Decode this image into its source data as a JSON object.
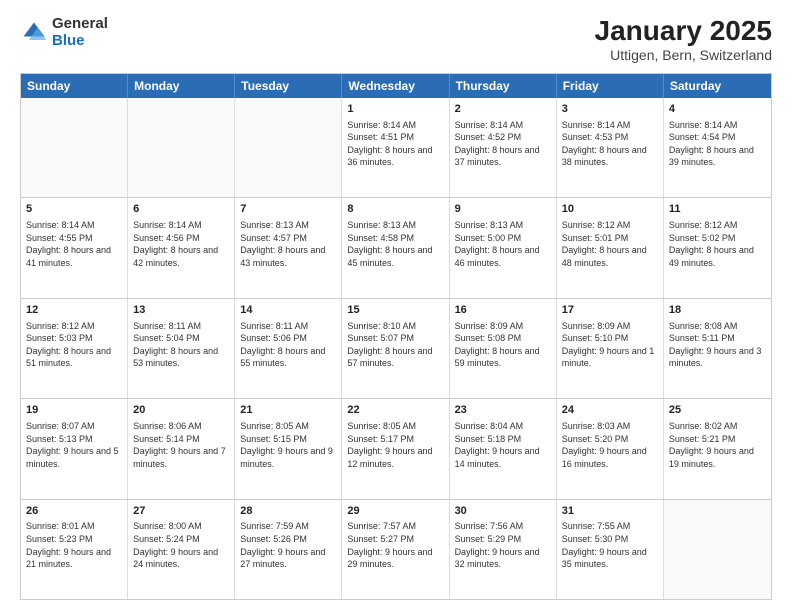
{
  "header": {
    "logo_general": "General",
    "logo_blue": "Blue",
    "title": "January 2025",
    "subtitle": "Uttigen, Bern, Switzerland"
  },
  "calendar": {
    "days_of_week": [
      "Sunday",
      "Monday",
      "Tuesday",
      "Wednesday",
      "Thursday",
      "Friday",
      "Saturday"
    ],
    "weeks": [
      [
        {
          "day": "",
          "text": ""
        },
        {
          "day": "",
          "text": ""
        },
        {
          "day": "",
          "text": ""
        },
        {
          "day": "1",
          "text": "Sunrise: 8:14 AM\nSunset: 4:51 PM\nDaylight: 8 hours\nand 36 minutes."
        },
        {
          "day": "2",
          "text": "Sunrise: 8:14 AM\nSunset: 4:52 PM\nDaylight: 8 hours\nand 37 minutes."
        },
        {
          "day": "3",
          "text": "Sunrise: 8:14 AM\nSunset: 4:53 PM\nDaylight: 8 hours\nand 38 minutes."
        },
        {
          "day": "4",
          "text": "Sunrise: 8:14 AM\nSunset: 4:54 PM\nDaylight: 8 hours\nand 39 minutes."
        }
      ],
      [
        {
          "day": "5",
          "text": "Sunrise: 8:14 AM\nSunset: 4:55 PM\nDaylight: 8 hours\nand 41 minutes."
        },
        {
          "day": "6",
          "text": "Sunrise: 8:14 AM\nSunset: 4:56 PM\nDaylight: 8 hours\nand 42 minutes."
        },
        {
          "day": "7",
          "text": "Sunrise: 8:13 AM\nSunset: 4:57 PM\nDaylight: 8 hours\nand 43 minutes."
        },
        {
          "day": "8",
          "text": "Sunrise: 8:13 AM\nSunset: 4:58 PM\nDaylight: 8 hours\nand 45 minutes."
        },
        {
          "day": "9",
          "text": "Sunrise: 8:13 AM\nSunset: 5:00 PM\nDaylight: 8 hours\nand 46 minutes."
        },
        {
          "day": "10",
          "text": "Sunrise: 8:12 AM\nSunset: 5:01 PM\nDaylight: 8 hours\nand 48 minutes."
        },
        {
          "day": "11",
          "text": "Sunrise: 8:12 AM\nSunset: 5:02 PM\nDaylight: 8 hours\nand 49 minutes."
        }
      ],
      [
        {
          "day": "12",
          "text": "Sunrise: 8:12 AM\nSunset: 5:03 PM\nDaylight: 8 hours\nand 51 minutes."
        },
        {
          "day": "13",
          "text": "Sunrise: 8:11 AM\nSunset: 5:04 PM\nDaylight: 8 hours\nand 53 minutes."
        },
        {
          "day": "14",
          "text": "Sunrise: 8:11 AM\nSunset: 5:06 PM\nDaylight: 8 hours\nand 55 minutes."
        },
        {
          "day": "15",
          "text": "Sunrise: 8:10 AM\nSunset: 5:07 PM\nDaylight: 8 hours\nand 57 minutes."
        },
        {
          "day": "16",
          "text": "Sunrise: 8:09 AM\nSunset: 5:08 PM\nDaylight: 8 hours\nand 59 minutes."
        },
        {
          "day": "17",
          "text": "Sunrise: 8:09 AM\nSunset: 5:10 PM\nDaylight: 9 hours\nand 1 minute."
        },
        {
          "day": "18",
          "text": "Sunrise: 8:08 AM\nSunset: 5:11 PM\nDaylight: 9 hours\nand 3 minutes."
        }
      ],
      [
        {
          "day": "19",
          "text": "Sunrise: 8:07 AM\nSunset: 5:13 PM\nDaylight: 9 hours\nand 5 minutes."
        },
        {
          "day": "20",
          "text": "Sunrise: 8:06 AM\nSunset: 5:14 PM\nDaylight: 9 hours\nand 7 minutes."
        },
        {
          "day": "21",
          "text": "Sunrise: 8:05 AM\nSunset: 5:15 PM\nDaylight: 9 hours\nand 9 minutes."
        },
        {
          "day": "22",
          "text": "Sunrise: 8:05 AM\nSunset: 5:17 PM\nDaylight: 9 hours\nand 12 minutes."
        },
        {
          "day": "23",
          "text": "Sunrise: 8:04 AM\nSunset: 5:18 PM\nDaylight: 9 hours\nand 14 minutes."
        },
        {
          "day": "24",
          "text": "Sunrise: 8:03 AM\nSunset: 5:20 PM\nDaylight: 9 hours\nand 16 minutes."
        },
        {
          "day": "25",
          "text": "Sunrise: 8:02 AM\nSunset: 5:21 PM\nDaylight: 9 hours\nand 19 minutes."
        }
      ],
      [
        {
          "day": "26",
          "text": "Sunrise: 8:01 AM\nSunset: 5:23 PM\nDaylight: 9 hours\nand 21 minutes."
        },
        {
          "day": "27",
          "text": "Sunrise: 8:00 AM\nSunset: 5:24 PM\nDaylight: 9 hours\nand 24 minutes."
        },
        {
          "day": "28",
          "text": "Sunrise: 7:59 AM\nSunset: 5:26 PM\nDaylight: 9 hours\nand 27 minutes."
        },
        {
          "day": "29",
          "text": "Sunrise: 7:57 AM\nSunset: 5:27 PM\nDaylight: 9 hours\nand 29 minutes."
        },
        {
          "day": "30",
          "text": "Sunrise: 7:56 AM\nSunset: 5:29 PM\nDaylight: 9 hours\nand 32 minutes."
        },
        {
          "day": "31",
          "text": "Sunrise: 7:55 AM\nSunset: 5:30 PM\nDaylight: 9 hours\nand 35 minutes."
        },
        {
          "day": "",
          "text": ""
        }
      ]
    ]
  }
}
